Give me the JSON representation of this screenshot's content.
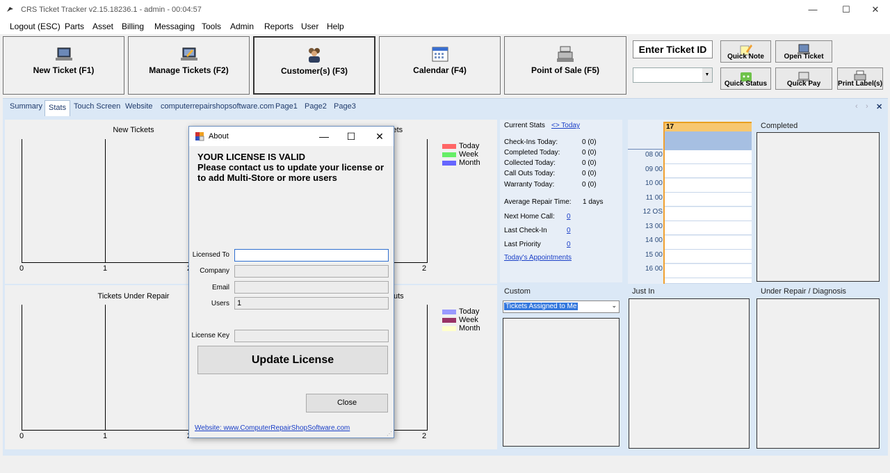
{
  "window": {
    "title": "CRS Ticket Tracker  v2.15.18236.1 - admin - 00:04:57"
  },
  "menu": [
    "Logout (ESC)",
    "Parts",
    "Asset",
    "Billing",
    "Messaging",
    "Tools",
    "Admin",
    "Reports",
    "User",
    "Help"
  ],
  "toolbar": {
    "new_ticket": "New Ticket (F1)",
    "manage_tickets": "Manage Tickets (F2)",
    "customers": "Customer(s) (F3)",
    "calendar": "Calendar (F4)",
    "pos": "Point of Sale (F5)",
    "enter_ticket_id": "Enter Ticket ID",
    "quick_note": "Quick Note",
    "open_ticket": "Open Ticket",
    "quick_status": "Quick Status",
    "quick_pay": "Quick Pay",
    "print_labels": "Print Label(s)"
  },
  "tabs": [
    "Summary",
    "Stats",
    "Touch Screen",
    "Website",
    "computerrepairshopsoftware.com",
    "Page1",
    "Page2",
    "Page3"
  ],
  "charts": {
    "new_tickets_title": "New Tickets",
    "right_top_title_fragment": "kets",
    "under_repair_title": "Tickets Under Repair",
    "right_bottom_title_fragment": "uts",
    "x_ticks": [
      "0",
      "1",
      "2"
    ],
    "legend_top": [
      {
        "label": "Today",
        "color": "#ff6666"
      },
      {
        "label": "Week",
        "color": "#66ee66"
      },
      {
        "label": "Month",
        "color": "#6666ff"
      }
    ],
    "legend_bottom": [
      {
        "label": "Today",
        "color": "#9999ff"
      },
      {
        "label": "Week",
        "color": "#993366"
      },
      {
        "label": "Month",
        "color": "#ffffcc"
      }
    ]
  },
  "stats": {
    "header": "Current Stats",
    "today_link": "<> Today",
    "rows": [
      {
        "label": "Check-Ins Today:",
        "value": "0 (0)"
      },
      {
        "label": "Completed Today:",
        "value": "0 (0)"
      },
      {
        "label": "Collected Today:",
        "value": "0 (0)"
      },
      {
        "label": "Call Outs Today:",
        "value": "0 (0)"
      },
      {
        "label": "Warranty Today:",
        "value": "0 (0)"
      }
    ],
    "avg_repair_label": "Average Repair Time:",
    "avg_repair_value": "1 days",
    "next_home_call_label": "Next Home Call:",
    "next_home_call_value": "0",
    "last_checkin_label": "Last Check-In",
    "last_checkin_value": "0",
    "last_priority_label": "Last Priority",
    "last_priority_value": "0",
    "appointments_link": "Today's Appointments"
  },
  "calendar": {
    "day": "17",
    "times": [
      {
        "h": "08",
        "m": "00"
      },
      {
        "h": "09",
        "m": "00"
      },
      {
        "h": "10",
        "m": "00"
      },
      {
        "h": "11",
        "m": "00"
      },
      {
        "h": "12",
        "m": "ОS"
      },
      {
        "h": "13",
        "m": "00"
      },
      {
        "h": "14",
        "m": "00"
      },
      {
        "h": "15",
        "m": "00"
      },
      {
        "h": "16",
        "m": "00"
      }
    ]
  },
  "sections": {
    "completed": "Completed",
    "custom": "Custom",
    "custom_select": "Tickets Assigned to Me",
    "just_in": "Just In",
    "under_repair": "Under Repair / Diagnosis"
  },
  "about": {
    "title": "About",
    "message": "YOUR LICENSE IS VALID\nPlease contact us to update your license or to add Multi-Store or more users",
    "licensed_to_label": "Licensed To",
    "licensed_to": "",
    "company_label": "Company",
    "company": "",
    "email_label": "Email",
    "email": "",
    "users_label": "Users",
    "users": "1",
    "license_key_label": "License Key",
    "license_key": "",
    "update_button": "Update License",
    "close_button": "Close",
    "website_link": "Website: www.ComputerRepairShopSoftware.com"
  }
}
